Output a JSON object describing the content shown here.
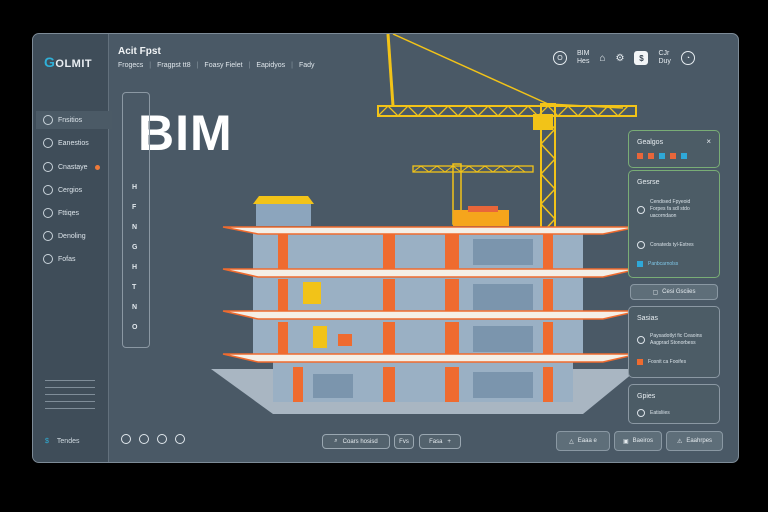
{
  "logo": {
    "mark": "G",
    "text": "OLMIT"
  },
  "project": {
    "title": "Acit Fpst"
  },
  "menu": [
    "Frogecs",
    "Fragpst tt8",
    "Foasy Fielet",
    "Eapidyos",
    "Fady"
  ],
  "sidebar": {
    "items": [
      {
        "label": "Fnsitios",
        "icon": "home-icon",
        "active": true
      },
      {
        "label": "Eanestios",
        "icon": "cube-icon",
        "active": false
      },
      {
        "label": "Cnastaye",
        "icon": "layers-icon",
        "active": false,
        "badge": true
      },
      {
        "label": "Cergios",
        "icon": "gear-icon",
        "active": false
      },
      {
        "label": "Fttiqes",
        "icon": "document-icon",
        "active": false
      },
      {
        "label": "Denoling",
        "icon": "chart-icon",
        "active": false
      },
      {
        "label": "Fofas",
        "icon": "folder-icon",
        "active": false
      }
    ],
    "footer_label": "Tendes"
  },
  "toolbar": {
    "user_icon_label": "O",
    "user_text": "BIM\nHes",
    "status_text": "CJr\nDuy",
    "square_label": "$"
  },
  "hero": {
    "title": "BIM"
  },
  "vertical_panel": [
    "H",
    "F",
    "N",
    "G",
    "H",
    "T",
    "N",
    "O"
  ],
  "right_panel": {
    "card1": {
      "header": "Gealgos",
      "close": "×",
      "icon_colors": [
        "#e8663a",
        "#e8663a",
        "#2fa8d8",
        "#e8663a",
        "#2fa8d8"
      ]
    },
    "card2": {
      "header": "Gesrse",
      "row1": "Cendised Fpyeoid\nForpes fa sdl stdo\nuacorndaon",
      "row2": "Conateds tyl-Estres",
      "link": "Panbcarnolss"
    },
    "button1": "Cesi Gsciies",
    "card3": {
      "header": "Sasias",
      "row1": "Paysadotlyt fic Ceaoins\nAagprad Stonorbess",
      "link": "Fosnit ca Fooifes"
    },
    "card4": {
      "header": "Gpies",
      "row1": "Eatisliies"
    }
  },
  "bottom": {
    "search_label": "Coars hosisd",
    "fps_label": "Fvs",
    "pill_label": "Fasa",
    "btn1": "Eaaa e",
    "btn2": "Baeiros",
    "btn3": "Eaahrpes"
  },
  "colors": {
    "accent": "#2fb0d8",
    "orange": "#ef6b2f",
    "crane": "#f2c318",
    "window_bg": "#4a5966"
  }
}
